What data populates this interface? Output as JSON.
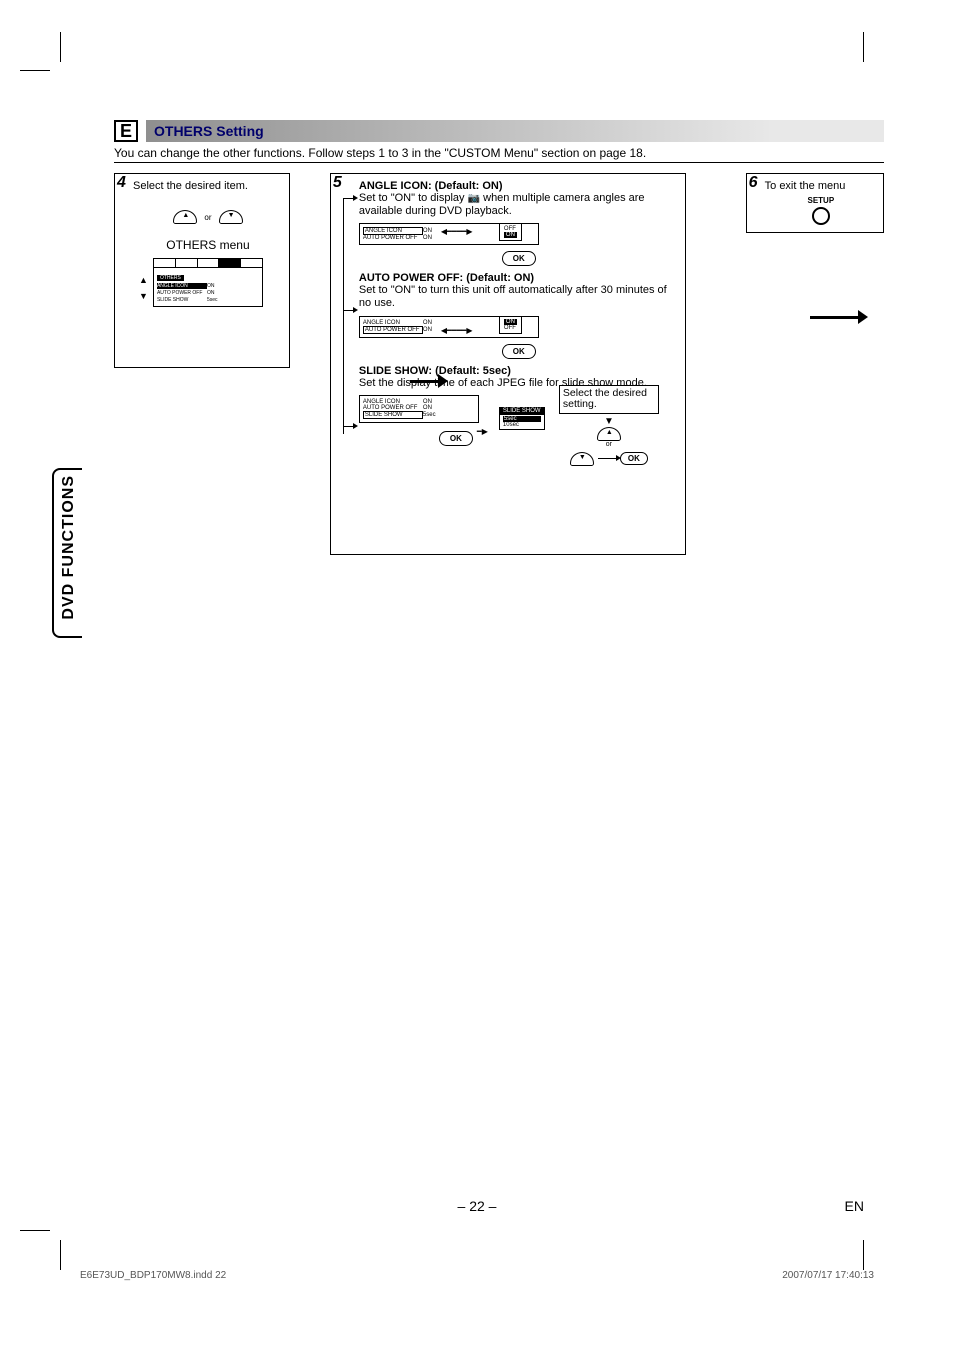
{
  "section": {
    "letter": "E",
    "title": "OTHERS Setting",
    "desc": "You can change the other functions. Follow steps 1 to 3 in the \"CUSTOM Menu\" section on page 18."
  },
  "step4": {
    "num": "4",
    "text": "Select the desired item.",
    "or": "or",
    "menuTitle": "OTHERS menu",
    "osdTab": "OTHERS",
    "rows": [
      {
        "k": "ANGLE ICON",
        "v": "ON",
        "sel": true
      },
      {
        "k": "AUTO POWER OFF",
        "v": "ON"
      },
      {
        "k": "SLIDE SHOW",
        "v": "5sec"
      }
    ]
  },
  "step5": {
    "num": "5",
    "angle": {
      "title": "ANGLE ICON: (Default: ON)",
      "desc1": "Set to \"ON\" to display ",
      "desc2": " when multiple camera angles are available during DVD playback.",
      "rows": [
        {
          "k": "ANGLE ICON",
          "v": "ON",
          "sel": true
        },
        {
          "k": "AUTO POWER OFF",
          "v": "ON"
        }
      ],
      "opts": [
        "OFF",
        "ON"
      ]
    },
    "auto": {
      "title": "AUTO POWER OFF: (Default: ON)",
      "desc": "Set to \"ON\" to turn this unit off automatically after 30 minutes of no use.",
      "rows": [
        {
          "k": "ANGLE ICON",
          "v": "ON"
        },
        {
          "k": "AUTO POWER OFF",
          "v": "ON",
          "sel": true
        }
      ],
      "opts": [
        "ON",
        "OFF"
      ]
    },
    "slide": {
      "title": "SLIDE SHOW: (Default: 5sec)",
      "desc": "Set the display time of each JPEG file for slide show mode.",
      "rows": [
        {
          "k": "ANGLE ICON",
          "v": "ON"
        },
        {
          "k": "AUTO POWER OFF",
          "v": "ON"
        },
        {
          "k": "SLIDE SHOW",
          "v": "5sec",
          "sel": true
        }
      ],
      "optHeader": "SLIDE SHOW",
      "opts": [
        "5sec",
        "10sec"
      ],
      "selectText": "Select the desired setting.",
      "or": "or"
    },
    "ok": "OK"
  },
  "step6": {
    "num": "6",
    "text": "To exit the menu",
    "setup": "SETUP"
  },
  "sideTab": "DVD FUNCTIONS",
  "footer": {
    "pageNum": "– 22 –",
    "lang": "EN",
    "file": "E6E73UD_BDP170MW8.indd   22",
    "date": "2007/07/17   17:40:13"
  }
}
